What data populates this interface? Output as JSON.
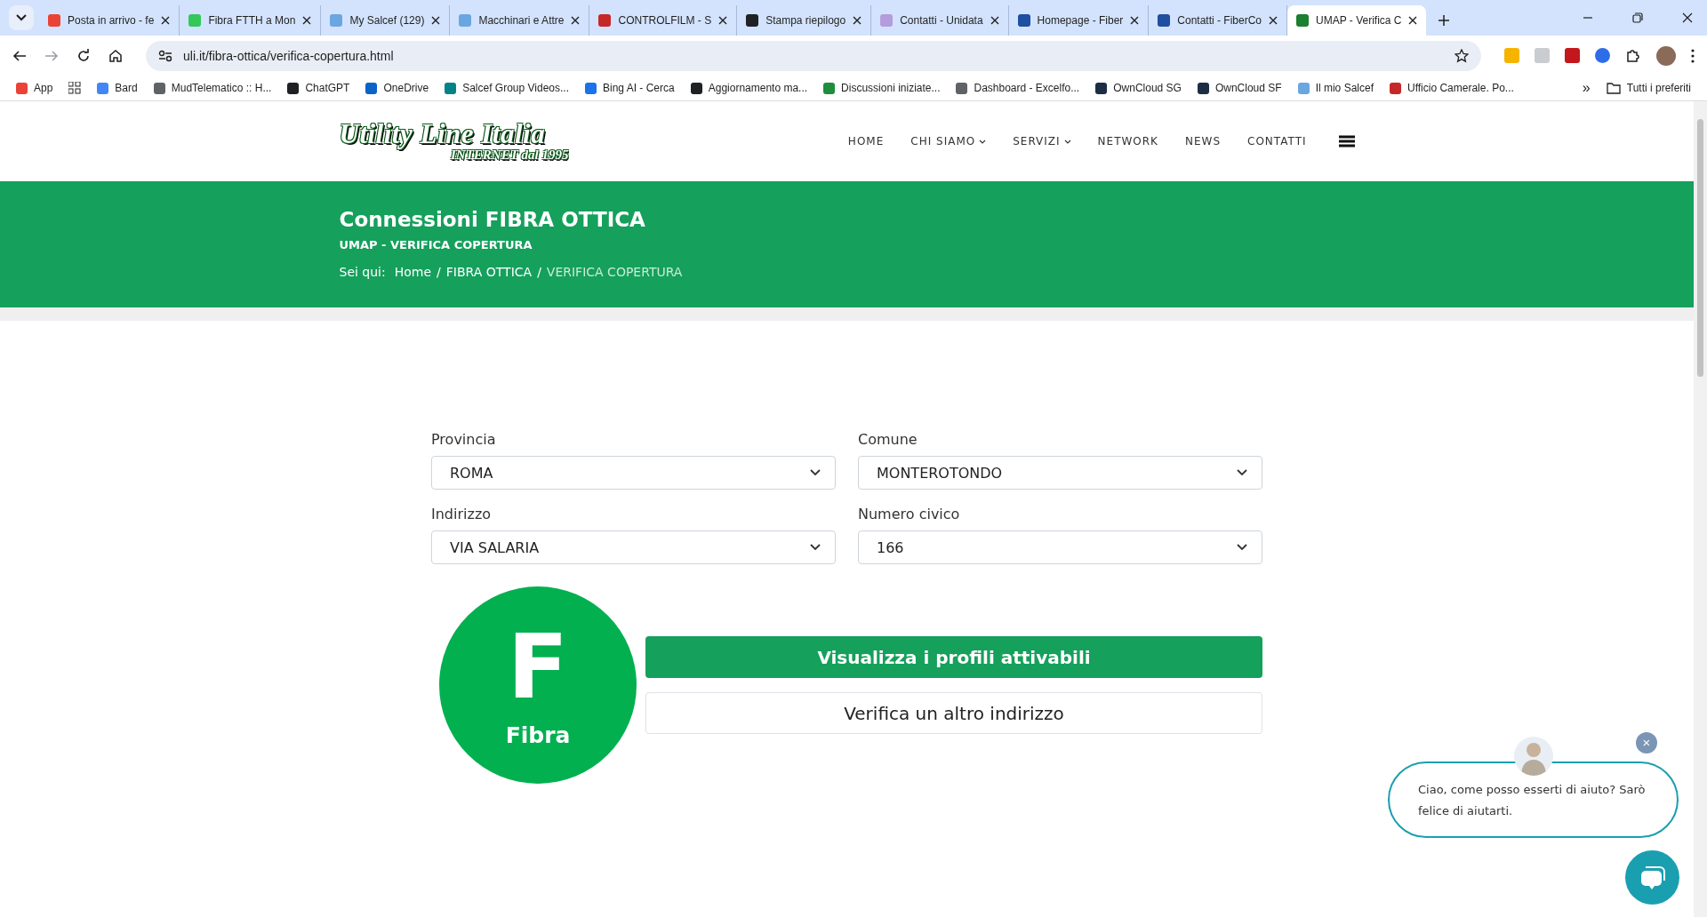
{
  "browser": {
    "tabs": [
      {
        "title": "Posta in arrivo - fe",
        "selected": false,
        "color": "#ea4335"
      },
      {
        "title": "Fibra FTTH a Mon",
        "selected": false,
        "color": "#34c759"
      },
      {
        "title": "My Salcef (129)",
        "selected": false,
        "color": "#6aa6e0"
      },
      {
        "title": "Macchinari e Attre",
        "selected": false,
        "color": "#6aa6e0"
      },
      {
        "title": "CONTROLFILM - S",
        "selected": false,
        "color": "#c62828"
      },
      {
        "title": "Stampa riepilogo",
        "selected": false,
        "color": "#202124"
      },
      {
        "title": "Contatti - Unidata",
        "selected": false,
        "color": "#b39ddb"
      },
      {
        "title": "Homepage - Fiber",
        "selected": false,
        "color": "#1e4fa0"
      },
      {
        "title": "Contatti - FiberCo",
        "selected": false,
        "color": "#1e4fa0"
      },
      {
        "title": "UMAP - Verifica C",
        "selected": true,
        "color": "#1a7f2e"
      }
    ],
    "url": "uli.it/fibra-ottica/verifica-copertura.html",
    "bookmarks": [
      {
        "label": "App",
        "color": "#ea4335"
      },
      {
        "label": "Bard",
        "color": "#4285f4"
      },
      {
        "label": "MudTelematico :: H...",
        "color": "#5f6368"
      },
      {
        "label": "ChatGPT",
        "color": "#202124"
      },
      {
        "label": "OneDrive",
        "color": "#0a64c8"
      },
      {
        "label": "Salcef Group Videos...",
        "color": "#038387"
      },
      {
        "label": "Bing AI - Cerca",
        "color": "#1a73e8"
      },
      {
        "label": "Aggiornamento ma...",
        "color": "#202124"
      },
      {
        "label": "Discussioni iniziate...",
        "color": "#1e8e3e"
      },
      {
        "label": "Dashboard - Excelfo...",
        "color": "#5f6368"
      },
      {
        "label": "OwnCloud SG",
        "color": "#1d2d44"
      },
      {
        "label": "OwnCloud SF",
        "color": "#1d2d44"
      },
      {
        "label": "Il mio Salcef",
        "color": "#6aa6e0"
      },
      {
        "label": "Ufficio Camerale. Po...",
        "color": "#c62828"
      }
    ],
    "more": "»",
    "all_bookmarks": "Tutti i preferiti"
  },
  "site": {
    "logo": {
      "title": "Utility Line Italia",
      "subtitle": "INTERNET dal 1995"
    },
    "nav": [
      {
        "label": "HOME",
        "dropdown": false
      },
      {
        "label": "CHI SIAMO",
        "dropdown": true
      },
      {
        "label": "SERVIZI",
        "dropdown": true
      },
      {
        "label": "NETWORK",
        "dropdown": false
      },
      {
        "label": "NEWS",
        "dropdown": false
      },
      {
        "label": "CONTATTI",
        "dropdown": false
      }
    ],
    "banner": {
      "title": "Connessioni FIBRA OTTICA",
      "subtitle": "UMAP - VERIFICA COPERTURA",
      "breadcrumb_label": "Sei qui:",
      "breadcrumb": [
        "Home",
        "FIBRA OTTICA",
        "VERIFICA COPERTURA"
      ],
      "separator": "/"
    },
    "form": [
      {
        "label": "Provincia",
        "value": "ROMA"
      },
      {
        "label": "Comune",
        "value": "MONTEROTONDO"
      },
      {
        "label": "Indirizzo",
        "value": "VIA SALARIA"
      },
      {
        "label": "Numero civico",
        "value": "166"
      }
    ],
    "result": {
      "letter": "F",
      "caption": "Fibra"
    },
    "buttons": [
      {
        "label": "Visualizza i profili attivabili",
        "kind": "primary"
      },
      {
        "label": "Verifica un altro indirizzo",
        "kind": "secondary"
      }
    ],
    "chat": {
      "message": "Ciao, come posso esserti di aiuto? Sarò felice di aiutarti.",
      "close": "×"
    }
  }
}
